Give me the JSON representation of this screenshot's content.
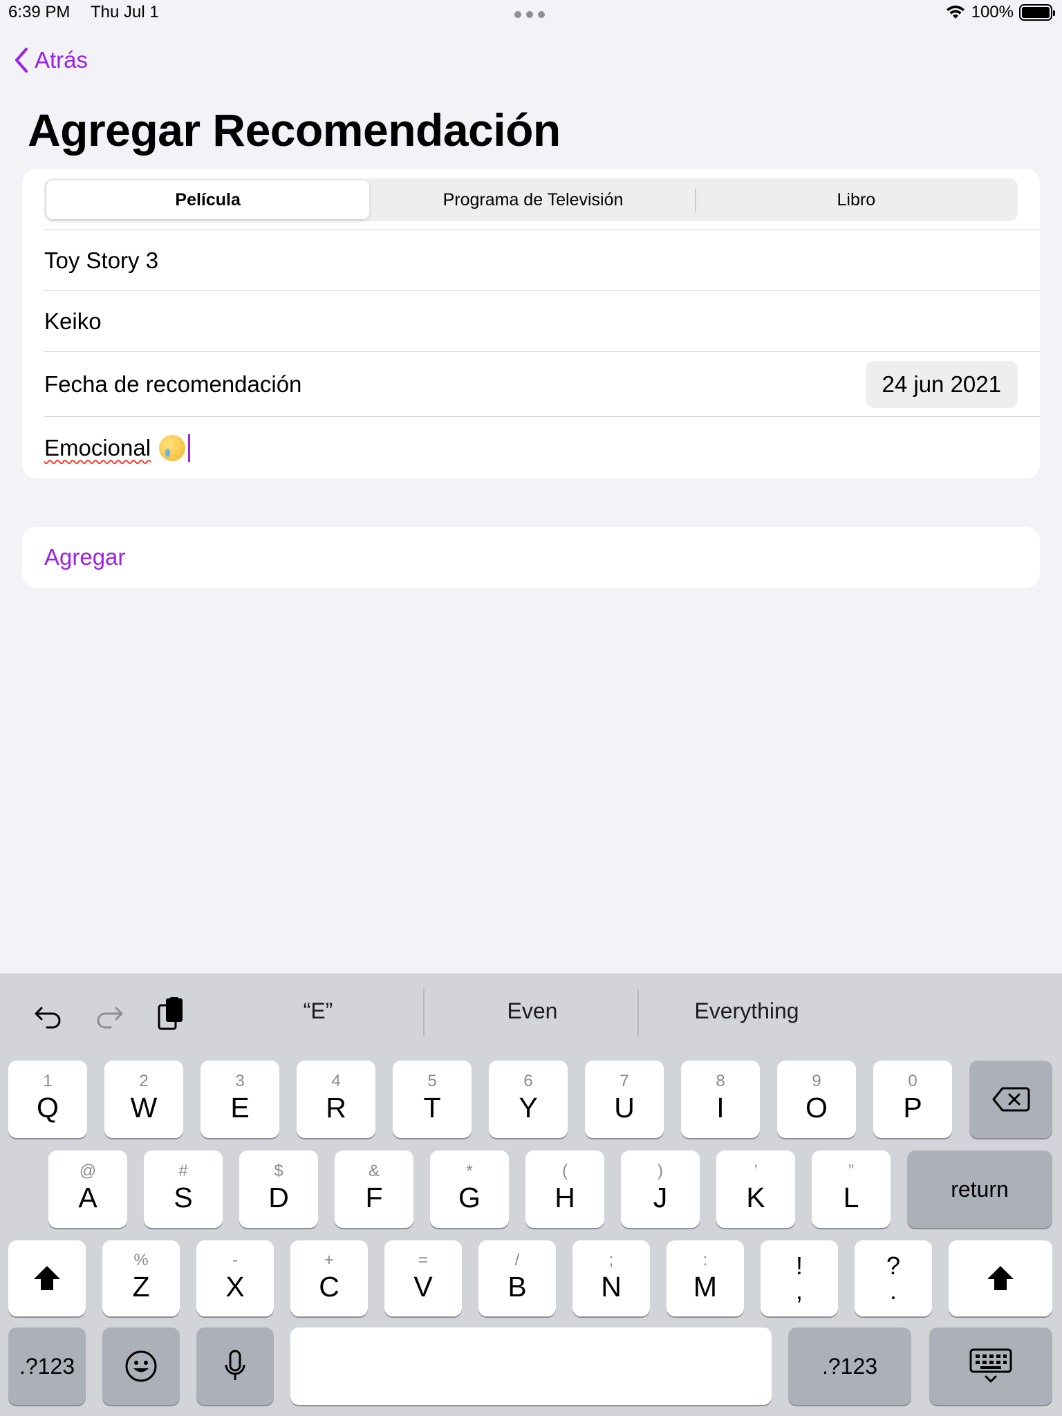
{
  "status_bar": {
    "time": "6:39 PM",
    "date": "Thu Jul 1",
    "battery": "100%"
  },
  "nav": {
    "back_label": "Atrás",
    "title": "Agregar Recomendación"
  },
  "segments": [
    {
      "label": "Película",
      "selected": true
    },
    {
      "label": "Programa de Televisión",
      "selected": false
    },
    {
      "label": "Libro",
      "selected": false
    }
  ],
  "form": {
    "title_value": "Toy Story 3",
    "recommender_value": "Keiko",
    "date_label": "Fecha de recomendación",
    "date_value": "24 jun 2021",
    "note_value": "Emocional"
  },
  "add_button": "Agregar",
  "colors": {
    "accent": "#9a22e3",
    "background": "#f2f2f7",
    "keyboard_bg": "#d2d4da"
  },
  "keyboard": {
    "suggestions": [
      "“E”",
      "Even",
      "Everything"
    ],
    "row1": [
      {
        "main": "Q",
        "sub": "1"
      },
      {
        "main": "W",
        "sub": "2"
      },
      {
        "main": "E",
        "sub": "3"
      },
      {
        "main": "R",
        "sub": "4"
      },
      {
        "main": "T",
        "sub": "5"
      },
      {
        "main": "Y",
        "sub": "6"
      },
      {
        "main": "U",
        "sub": "7"
      },
      {
        "main": "I",
        "sub": "8"
      },
      {
        "main": "O",
        "sub": "9"
      },
      {
        "main": "P",
        "sub": "0"
      }
    ],
    "row2": [
      {
        "main": "A",
        "sub": "@"
      },
      {
        "main": "S",
        "sub": "#"
      },
      {
        "main": "D",
        "sub": "$"
      },
      {
        "main": "F",
        "sub": "&"
      },
      {
        "main": "G",
        "sub": "*"
      },
      {
        "main": "H",
        "sub": "("
      },
      {
        "main": "J",
        "sub": ")"
      },
      {
        "main": "K",
        "sub": "’"
      },
      {
        "main": "L",
        "sub": "”"
      }
    ],
    "row3": [
      {
        "main": "Z",
        "sub": "%"
      },
      {
        "main": "X",
        "sub": "-"
      },
      {
        "main": "C",
        "sub": "+"
      },
      {
        "main": "V",
        "sub": "="
      },
      {
        "main": "B",
        "sub": "/"
      },
      {
        "main": "N",
        "sub": ";"
      },
      {
        "main": "M",
        "sub": ":"
      },
      {
        "main": ",",
        "sub": "!"
      },
      {
        "main": ".",
        "sub": "?"
      }
    ],
    "return_label": "return",
    "numbers_label": ".?123"
  }
}
